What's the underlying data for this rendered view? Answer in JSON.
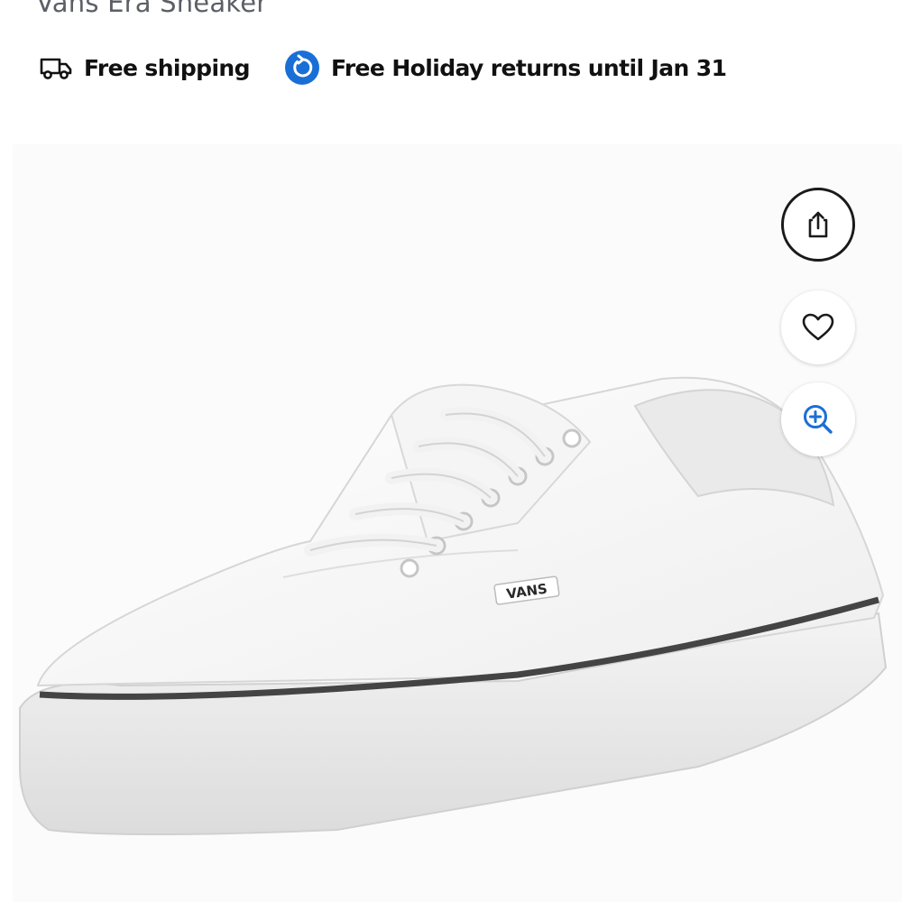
{
  "product": {
    "title": "Vans Era Sneaker"
  },
  "perks": [
    {
      "icon": "truck-icon",
      "label": "Free shipping"
    },
    {
      "icon": "returns-icon",
      "label": "Free Holiday returns until Jan 31",
      "icon_color": "#1a6fd6"
    }
  ],
  "image": {
    "brand_logo_text": "VANS",
    "alt": "White Vans Era sneaker"
  },
  "actions": [
    {
      "icon": "share-icon"
    },
    {
      "icon": "heart-icon"
    },
    {
      "icon": "zoom-in-icon",
      "color": "#1a6fd6"
    }
  ]
}
